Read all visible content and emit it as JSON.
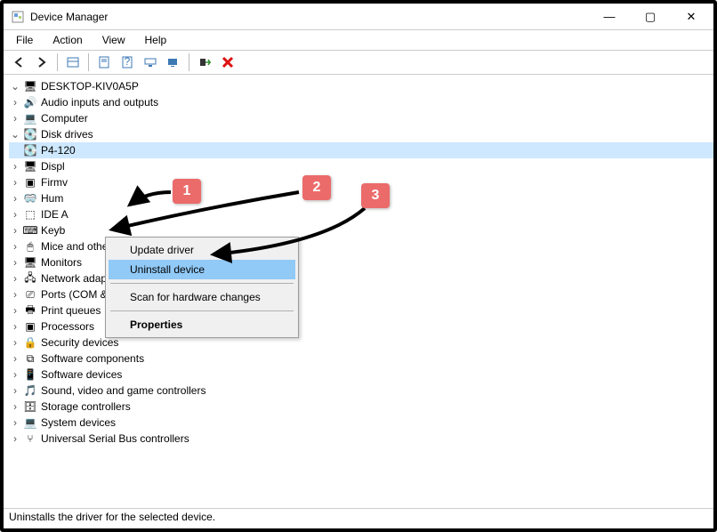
{
  "window": {
    "title": "Device Manager",
    "btn_min": "—",
    "btn_max": "▢",
    "btn_close": "✕"
  },
  "menu": [
    "File",
    "Action",
    "View",
    "Help"
  ],
  "status_bar": "Uninstalls the driver for the selected device.",
  "root_name": "DESKTOP-KIV0A5P",
  "tree": [
    {
      "label": "Audio inputs and outputs",
      "icon": "🔊",
      "exp": false
    },
    {
      "label": "Computer",
      "icon": "💻",
      "exp": false
    },
    {
      "label": "Disk drives",
      "icon": "💽",
      "exp": true,
      "children": [
        {
          "label": "P4-120",
          "icon": "💽",
          "selected": true
        }
      ]
    },
    {
      "label": "Display adapters",
      "short": "Displ",
      "icon": "🖥",
      "exp": false
    },
    {
      "label": "Firmware",
      "short": "Firmv",
      "icon": "▣",
      "exp": false
    },
    {
      "label": "Human Interface Devices",
      "short": "Hum",
      "icon": "🥽",
      "exp": false
    },
    {
      "label": "IDE ATA/ATAPI controllers",
      "short": "IDE A",
      "icon": "⬚",
      "exp": false
    },
    {
      "label": "Keyboards",
      "short": "Keyb",
      "icon": "⌨",
      "exp": false
    },
    {
      "label": "Mice and other pointing devices",
      "icon": "🖱",
      "exp": false
    },
    {
      "label": "Monitors",
      "icon": "🖥",
      "exp": false
    },
    {
      "label": "Network adapters",
      "icon": "🖧",
      "exp": false
    },
    {
      "label": "Ports (COM & LPT)",
      "icon": "⎚",
      "exp": false
    },
    {
      "label": "Print queues",
      "icon": "🖶",
      "exp": false
    },
    {
      "label": "Processors",
      "icon": "▣",
      "exp": false
    },
    {
      "label": "Security devices",
      "icon": "🔒",
      "exp": false
    },
    {
      "label": "Software components",
      "icon": "⧉",
      "exp": false
    },
    {
      "label": "Software devices",
      "icon": "📱",
      "exp": false
    },
    {
      "label": "Sound, video and game controllers",
      "icon": "🎵",
      "exp": false
    },
    {
      "label": "Storage controllers",
      "icon": "🗄",
      "exp": false
    },
    {
      "label": "System devices",
      "icon": "💻",
      "exp": false
    },
    {
      "label": "Universal Serial Bus controllers",
      "icon": "⑂",
      "exp": false
    }
  ],
  "context_menu": {
    "update": "Update driver",
    "uninstall": "Uninstall device",
    "scan": "Scan for hardware changes",
    "properties": "Properties"
  },
  "callouts": {
    "c1": "1",
    "c2": "2",
    "c3": "3"
  }
}
